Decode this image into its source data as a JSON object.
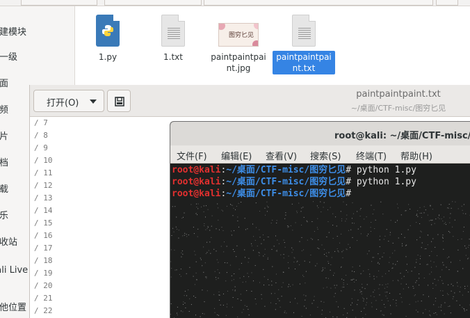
{
  "file_manager": {
    "sidebar": [
      "新建模块",
      "上一级",
      "桌面",
      "视频",
      "图片",
      "文档",
      "下载",
      "音乐",
      "回收站",
      "Kali Live",
      "其他位置"
    ],
    "files": [
      {
        "name": "1.py",
        "icon": "python-file-icon",
        "selected": false
      },
      {
        "name": "1.txt",
        "icon": "text-file-icon",
        "selected": false
      },
      {
        "name": "paintpaintpaint.jpg",
        "icon": "image-file-icon",
        "selected": false
      },
      {
        "name": "paintpaintpaint.txt",
        "icon": "text-file-icon",
        "selected": true
      }
    ]
  },
  "editor": {
    "open_label": "打开(O)",
    "title": "paintpaintpaint.txt",
    "subtitle": "~/桌面/CTF-misc/图穷匕见",
    "lines": [
      "/ 7",
      "/ 8",
      "/ 9",
      "/ 10",
      "/ 11",
      "/ 12",
      "/ 13",
      "/ 14",
      "/ 15",
      "/ 16",
      "/ 17",
      "/ 18",
      "/ 19",
      "/ 20",
      "/ 21",
      "/ 22"
    ]
  },
  "terminal": {
    "title": "root@kali: ~/桌面/CTF-misc/图穷匕见",
    "menu": [
      "文件(F)",
      "编辑(E)",
      "查看(V)",
      "搜索(S)",
      "终端(T)",
      "帮助(H)"
    ],
    "lines": [
      {
        "user": "root@kali",
        "sep": ":",
        "path": "~/桌面/CTF-misc/图穷匕见",
        "cmd": "# python 1.py"
      },
      {
        "user": "root@kali",
        "sep": ":",
        "path": "~/桌面/CTF-misc/图穷匕见",
        "cmd": "# python 1.py"
      },
      {
        "user": "root@kali",
        "sep": ":",
        "path": "~/桌面/CTF-misc/图穷匕见",
        "cmd": "# "
      }
    ]
  },
  "colors": {
    "selection": "#3584e4",
    "prompt_user": "#e3302f",
    "prompt_path": "#3d8ee8",
    "terminal_bg": "#1e1f1e"
  }
}
